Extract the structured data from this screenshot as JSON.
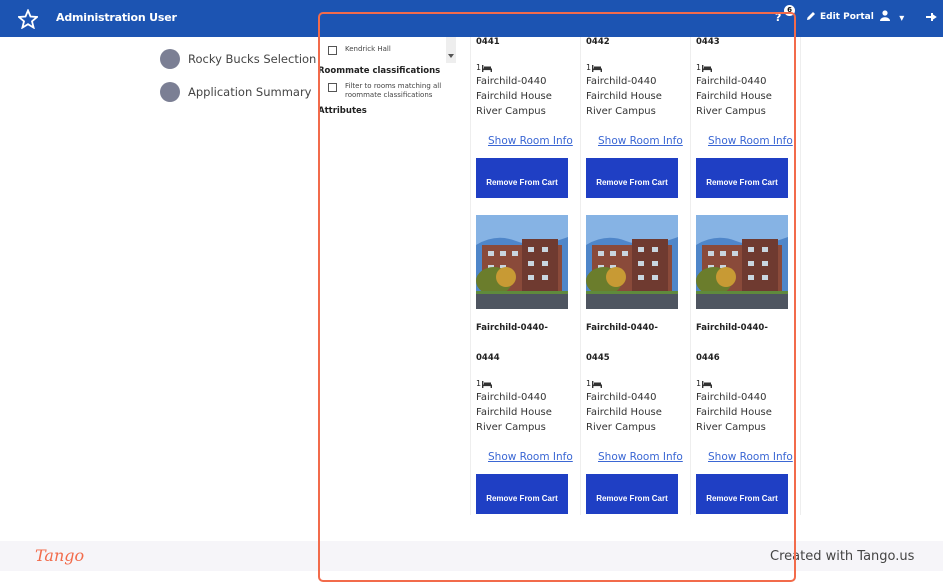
{
  "topbar": {
    "user": "Administration User",
    "help": "?",
    "badge": "6",
    "edit_portal": "Edit Portal",
    "user_menu": "▾"
  },
  "steps": [
    {
      "label": "Rocky Bucks Selection"
    },
    {
      "label": "Application Summary"
    }
  ],
  "filters": {
    "hall_option": "Kendrick Hall",
    "roommate_heading": "Roommate classifications",
    "roommate_option": "Filter to rooms matching all roommate classifications",
    "attributes_heading": "Attributes"
  },
  "rooms": [
    {
      "number": "0441",
      "beds": "1",
      "line1": "Fairchild-0440",
      "line2": "Fairchild House",
      "line3": "River Campus",
      "link": "Show Room Info",
      "button": "Remove From Cart"
    },
    {
      "number": "0442",
      "beds": "1",
      "line1": "Fairchild-0440",
      "line2": "Fairchild House",
      "line3": "River Campus",
      "link": "Show Room Info",
      "button": "Remove From Cart"
    },
    {
      "number": "0443",
      "beds": "1",
      "line1": "Fairchild-0440",
      "line2": "Fairchild House",
      "line3": "River Campus",
      "link": "Show Room Info",
      "button": "Remove From Cart"
    },
    {
      "title": "Fairchild-0440-",
      "number": "0444",
      "beds": "1",
      "line1": "Fairchild-0440",
      "line2": "Fairchild House",
      "line3": "River Campus",
      "link": "Show Room Info",
      "button": "Remove From Cart"
    },
    {
      "title": "Fairchild-0440-",
      "number": "0445",
      "beds": "1",
      "line1": "Fairchild-0440",
      "line2": "Fairchild House",
      "line3": "River Campus",
      "link": "Show Room Info",
      "button": "Remove From Cart"
    },
    {
      "title": "Fairchild-0440-",
      "number": "0446",
      "beds": "1",
      "line1": "Fairchild-0440",
      "line2": "Fairchild House",
      "line3": "River Campus",
      "link": "Show Room Info",
      "button": "Remove From Cart"
    }
  ],
  "footer": {
    "logo": "Tango",
    "created": "Created with Tango.us"
  },
  "colors": {
    "topbar": "#1c54b2",
    "button": "#1f3fc4",
    "link": "#3b67d4",
    "highlight": "#f26b4b"
  }
}
